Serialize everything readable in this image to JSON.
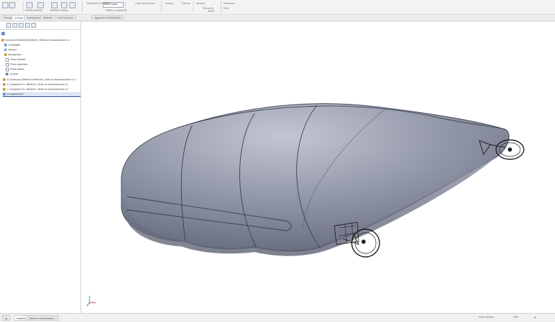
{
  "ribbon": {
    "tools": [
      "Svasatura",
      "Scala",
      "Modifica Feature",
      "Superficie di rinforzo",
      "Offset su superficie",
      "Linee di divisione",
      "Schizzo",
      "Cerchio",
      "Smusso",
      "Raccordo",
      "Scansiona",
      "Fissa",
      "Ripeti"
    ],
    "highlight_label": "Fillet Sfoglia"
  },
  "tabs": [
    "Funzioni",
    "Schizzo",
    "Valutazione",
    "Mobilità",
    "Crea Struttura",
    "Aggiunte SOLIDWORKS"
  ],
  "active_tab_index": 1,
  "sidebar": {
    "tree": [
      "Involucro Ambiente (Default) <Stato di visualizzazione-1>",
      "Cronologia",
      "Sensori",
      "Annotazioni",
      "Piano frontale",
      "Piano superiore",
      "Piano destro",
      "Origine",
      "(f) Involucro (Default<<Default>_Stato di visualizzazione-1>)",
      "(-) Supporto<1> (Default) <Stato di visualizzazione-1>",
      "(-) Supporto<2> (Default) <Stato di visualizzazione-1>",
      "Accoppiamenti"
    ]
  },
  "bottom_tabs": [
    "Modello",
    "Studio di movimento 1"
  ],
  "status_right": [
    "Sotto-definito",
    "MKS",
    "▲"
  ],
  "colors": {
    "shape_fill": "#8e93a3",
    "shape_light": "#b7bbc8",
    "shape_dark": "#5e6373",
    "accent": "#1f4f8f"
  },
  "icons": [
    "part-icon",
    "folder-icon",
    "sensor-icon",
    "annotation-icon",
    "plane-icon",
    "origin-icon",
    "assembly-icon",
    "mate-icon",
    "triad-icon"
  ]
}
